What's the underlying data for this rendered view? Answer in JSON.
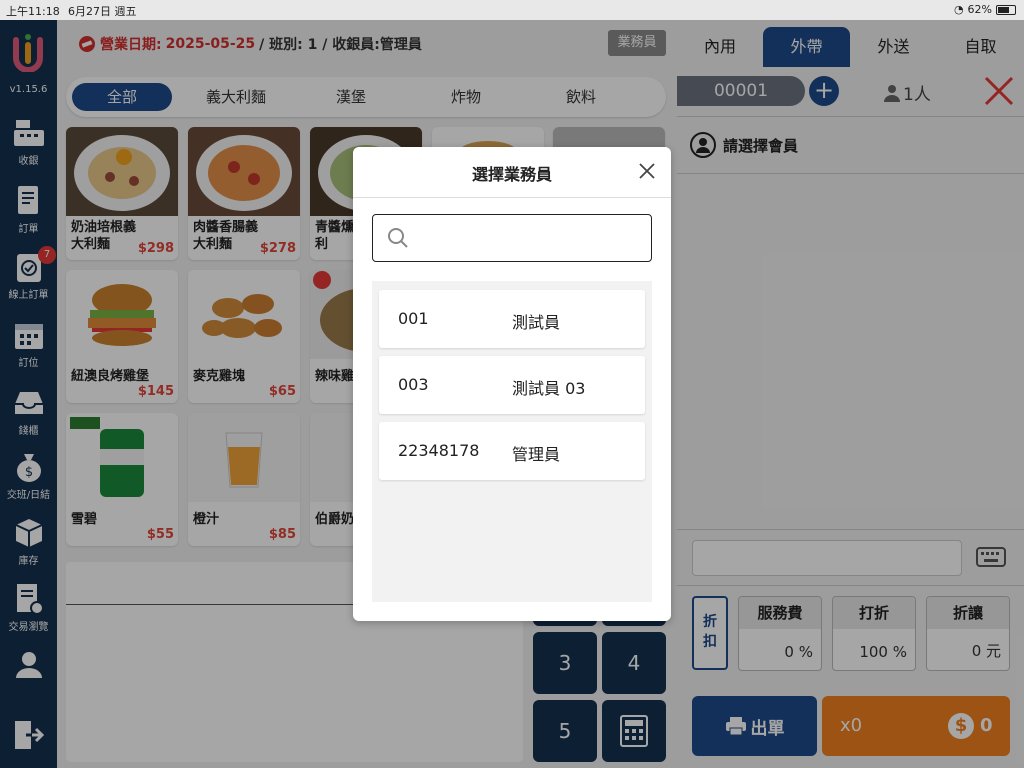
{
  "status_bar": {
    "time": "上午11:18",
    "date": "6月27日 週五",
    "battery": "62%"
  },
  "sidebar": {
    "version": "v1.15.6",
    "items": [
      {
        "label": "收銀",
        "icon": "cash-register-icon"
      },
      {
        "label": "訂單",
        "icon": "order-icon"
      },
      {
        "label": "線上訂單",
        "icon": "online-order-icon",
        "badge": "7"
      },
      {
        "label": "訂位",
        "icon": "calendar-icon"
      },
      {
        "label": "錢櫃",
        "icon": "drawer-icon"
      },
      {
        "label": "交班/日結",
        "icon": "money-bag-icon"
      },
      {
        "label": "庫存",
        "icon": "box-icon"
      },
      {
        "label": "交易瀏覽",
        "icon": "receipt-icon"
      },
      {
        "label": "",
        "icon": "user-icon"
      },
      {
        "label": "",
        "icon": "logout-icon"
      }
    ]
  },
  "header": {
    "biz_date_label": "營業日期:",
    "biz_date": "2025-05-25",
    "shift_info": "/ 班別: 1 / 收銀員:管理員",
    "sales_button": "業務員"
  },
  "categories": [
    "全部",
    "義大利麵",
    "漢堡",
    "炸物",
    "飲料"
  ],
  "products": [
    {
      "name": "奶油培根義大利麵",
      "price": "$298"
    },
    {
      "name": "肉醬香腸義大利麵",
      "price": "$278"
    },
    {
      "name": "青醬燻義大利",
      "price": ""
    },
    {
      "name": "紐澳良烤雞堡",
      "price": "$145"
    },
    {
      "name": "麥克雞塊",
      "price": "$65"
    },
    {
      "name": "辣味雞",
      "price": ""
    },
    {
      "name": "雪碧",
      "price": "$55"
    },
    {
      "name": "橙汁",
      "price": "$85"
    },
    {
      "name": "伯爵奶",
      "price": ""
    }
  ],
  "keypad": [
    "3",
    "4",
    "5"
  ],
  "order": {
    "tabs": [
      "內用",
      "外帶",
      "外送",
      "自取"
    ],
    "active_tab": "外帶",
    "order_no": "00001",
    "persons": "1人",
    "member_prompt": "請選擇會員",
    "discount_label": "折扣",
    "fees": [
      {
        "title": "服務費",
        "value": "0 %"
      },
      {
        "title": "打折",
        "value": "100 %"
      },
      {
        "title": "折讓",
        "value": "0 元"
      }
    ],
    "print_label": "出單",
    "pay_qty": "x0",
    "pay_amount": "0"
  },
  "modal": {
    "title": "選擇業務員",
    "search_placeholder": "",
    "staff": [
      {
        "code": "001",
        "name": "測試員"
      },
      {
        "code": "003",
        "name": "測試員 03"
      },
      {
        "code": "22348178",
        "name": "管理員"
      }
    ]
  },
  "colors": {
    "primary": "#1e4a8a",
    "sidebar": "#14304f",
    "accent": "#f08020",
    "price": "#e0453a"
  }
}
